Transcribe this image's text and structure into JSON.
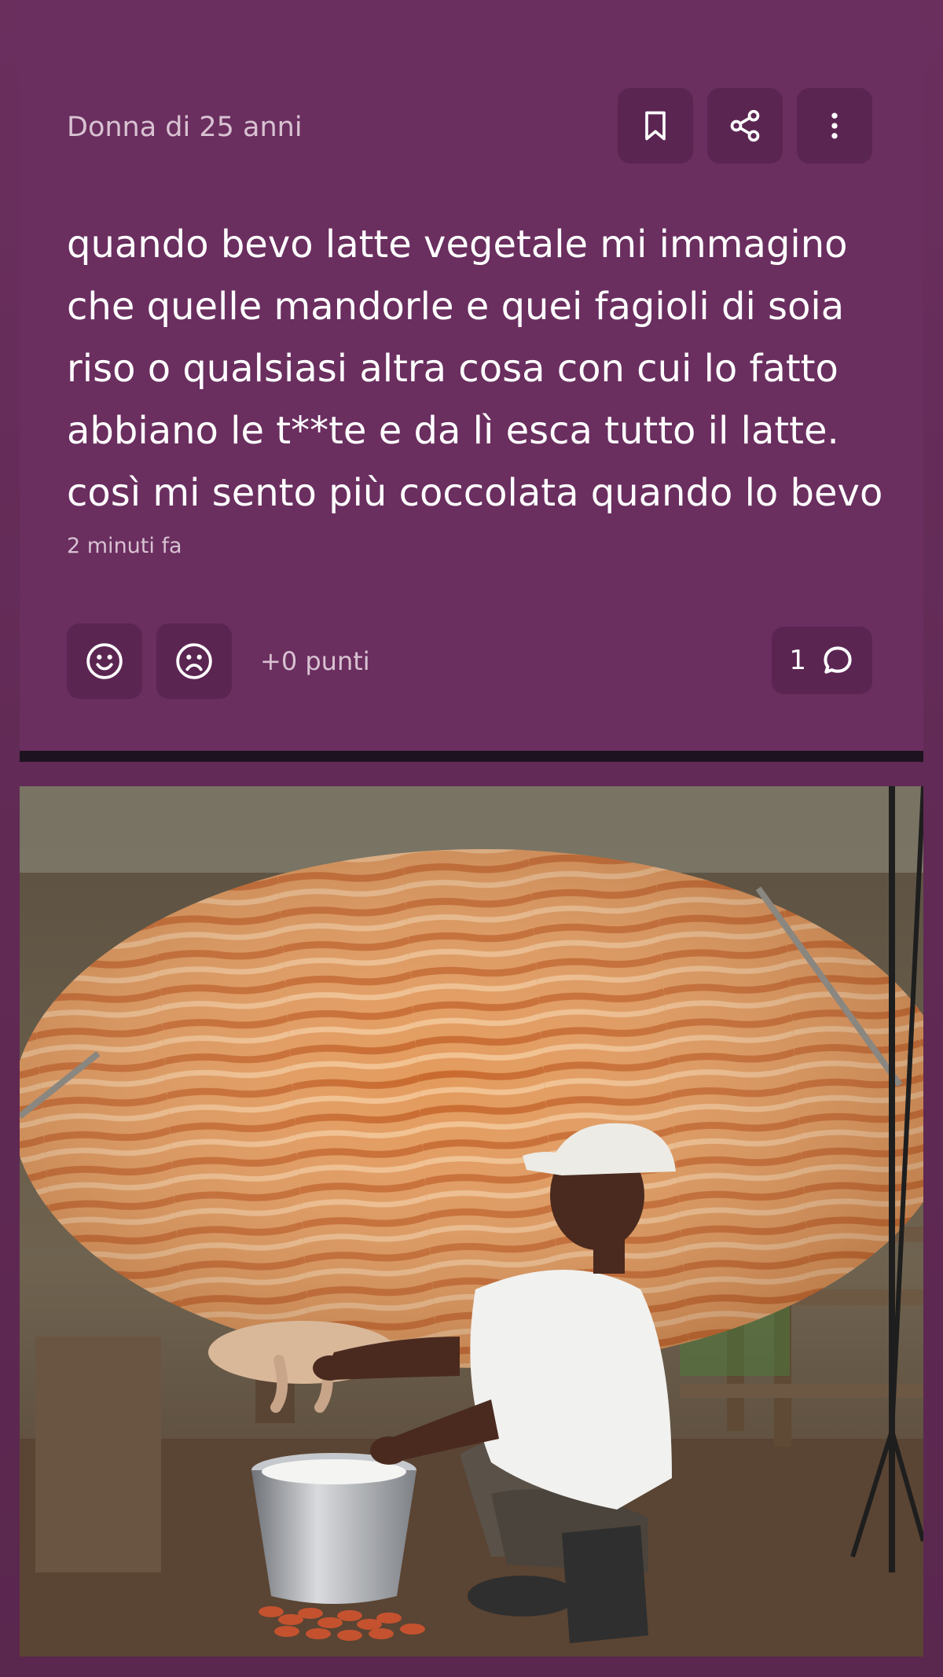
{
  "post": {
    "author": "Donna di 25 anni",
    "text": "quando bevo latte vegetale mi immagino che quelle mandorle e quei fagioli di soia riso o qualsiasi altra cosa con cui lo fatto abbiano le t**te e da lì esca tutto il latte. così mi sento più coccolata quando lo bevo",
    "timestamp": "2 minuti fa",
    "points": "+0 punti",
    "comment_count": "1"
  },
  "icons": {
    "bookmark": "bookmark-icon",
    "share": "share-icon",
    "more": "more-vertical-icon",
    "happy": "smiley-icon",
    "sad": "sad-face-icon",
    "comment": "comment-bubble-icon"
  },
  "colors": {
    "card_bg": "#6a2e5f",
    "button_bg": "#5b2552",
    "text": "#ffffff",
    "muted_text": "#d8c2d2"
  }
}
